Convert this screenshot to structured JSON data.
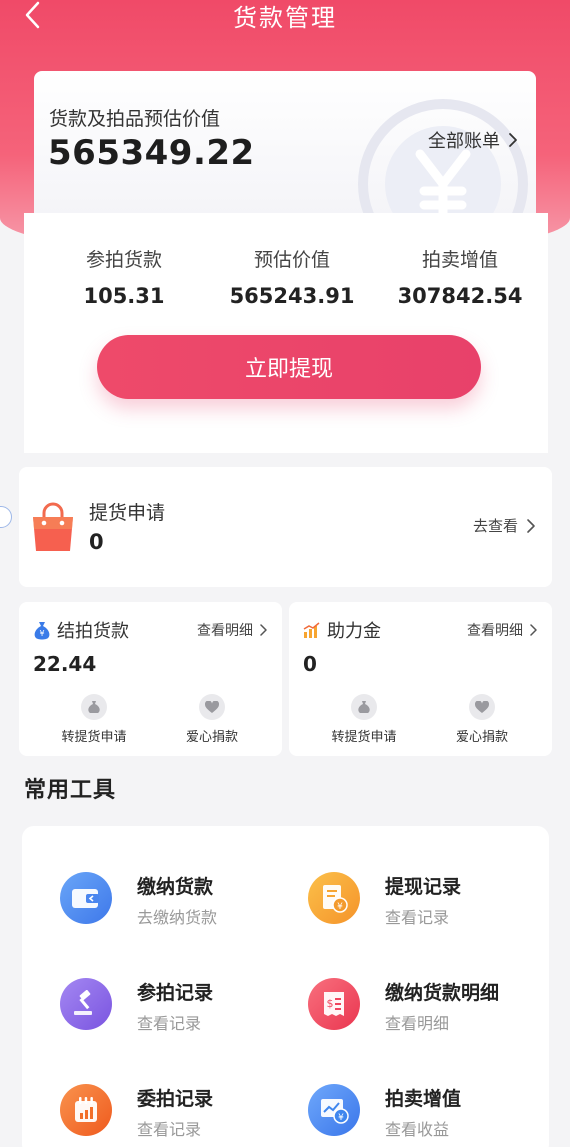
{
  "header": {
    "title": "货款管理"
  },
  "summary": {
    "label": "货款及拍品预估价值",
    "amount": "565349.22",
    "all_bills": "全部账单"
  },
  "stats": [
    {
      "label": "参拍货款",
      "value": "105.31"
    },
    {
      "label": "预估价值",
      "value": "565243.91"
    },
    {
      "label": "拍卖增值",
      "value": "307842.54"
    }
  ],
  "withdraw_button": "立即提现",
  "pickup": {
    "title": "提货申请",
    "count": "0",
    "link": "去查看"
  },
  "settled": {
    "title": "结拍货款",
    "detail": "查看明细",
    "amount": "22.44",
    "actions": [
      "转提货申请",
      "爱心捐款"
    ]
  },
  "assist": {
    "title": "助力金",
    "detail": "查看明细",
    "amount": "0",
    "actions": [
      "转提货申请",
      "爱心捐款"
    ]
  },
  "tools_section": {
    "title": "常用工具"
  },
  "tools": [
    {
      "name": "缴纳货款",
      "sub": "去缴纳货款",
      "icon": "wallet-icon",
      "color": "#4a86ef"
    },
    {
      "name": "提现记录",
      "sub": "查看记录",
      "icon": "withdraw-record-icon",
      "color": "#f7a531"
    },
    {
      "name": "参拍记录",
      "sub": "查看记录",
      "icon": "gavel-icon",
      "color": "#8b62e8"
    },
    {
      "name": "缴纳货款明细",
      "sub": "查看明细",
      "icon": "receipt-icon",
      "color": "#f0455e"
    },
    {
      "name": "委拍记录",
      "sub": "查看记录",
      "icon": "calendar-chart-icon",
      "color": "#f26f2a"
    },
    {
      "name": "拍卖增值",
      "sub": "查看收益",
      "icon": "trend-icon",
      "color": "#3f86ee"
    }
  ],
  "colors": {
    "brand": "#ee4a6a",
    "text": "#222222",
    "muted": "#999999"
  }
}
